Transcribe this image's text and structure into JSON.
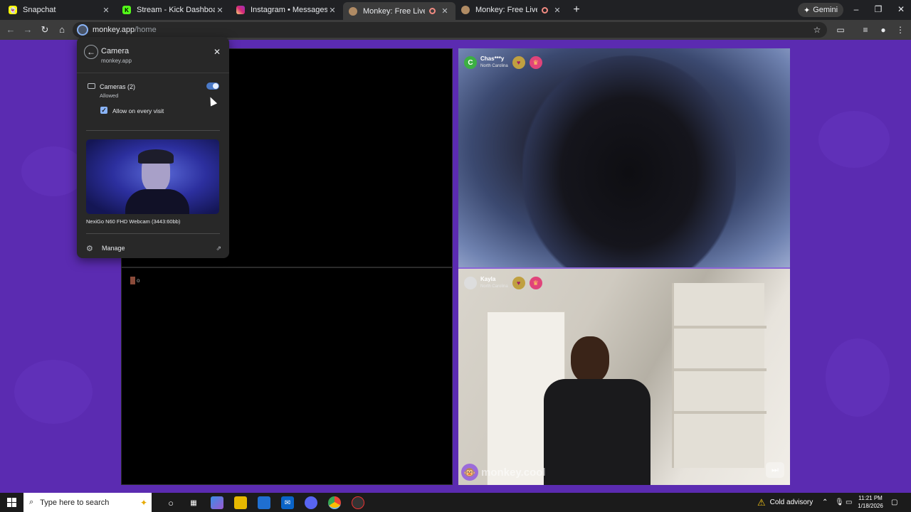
{
  "tabs": [
    {
      "title": "Snapchat",
      "favicon_color": "#fffc00",
      "favicon": "snapchat-icon",
      "active": false,
      "recording": false
    },
    {
      "title": "Stream - Kick Dashboard",
      "favicon_color": "#53fc18",
      "favicon": "kick-icon",
      "active": false,
      "recording": false
    },
    {
      "title": "Instagram • Messages",
      "favicon_color": "#e1306c",
      "favicon": "instagram-icon",
      "active": false,
      "recording": false
    },
    {
      "title": "Monkey: Free Live Video Ch",
      "favicon_color": "#b08b64",
      "favicon": "monkey-icon",
      "active": true,
      "recording": true
    },
    {
      "title": "Monkey: Free Live Video Ch",
      "favicon_color": "#b08b64",
      "favicon": "monkey-icon",
      "active": false,
      "recording": true
    }
  ],
  "gemini_label": "Gemini",
  "address": {
    "domain": "monkey.app",
    "path": "/home"
  },
  "popup": {
    "title": "Camera",
    "site": "monkey.app",
    "cameras_label": "Cameras (2)",
    "cameras_status": "Allowed",
    "toggle_on": true,
    "allow_every_visit_label": "Allow on every visit",
    "allow_every_visit_checked": true,
    "camera_name": "NexiGo N60 FHD Webcam (3443:60bb)",
    "manage_label": "Manage"
  },
  "peers": [
    {
      "name": "Chas***y",
      "location": "North Carolina",
      "initial": "C",
      "avatar_color": "#3cb043"
    },
    {
      "name": "Kayla",
      "location": "North Carolina",
      "initial": "",
      "avatar_color": "#dddddd"
    }
  ],
  "watermark": "monkey.cool",
  "taskbar": {
    "search_placeholder": "Type here to search",
    "weather": "Cold advisory",
    "time": "11:21 PM",
    "date": "1/18/2026"
  },
  "colors": {
    "page_bg": "#5b2bb1",
    "accent": "#8ab4f8"
  }
}
